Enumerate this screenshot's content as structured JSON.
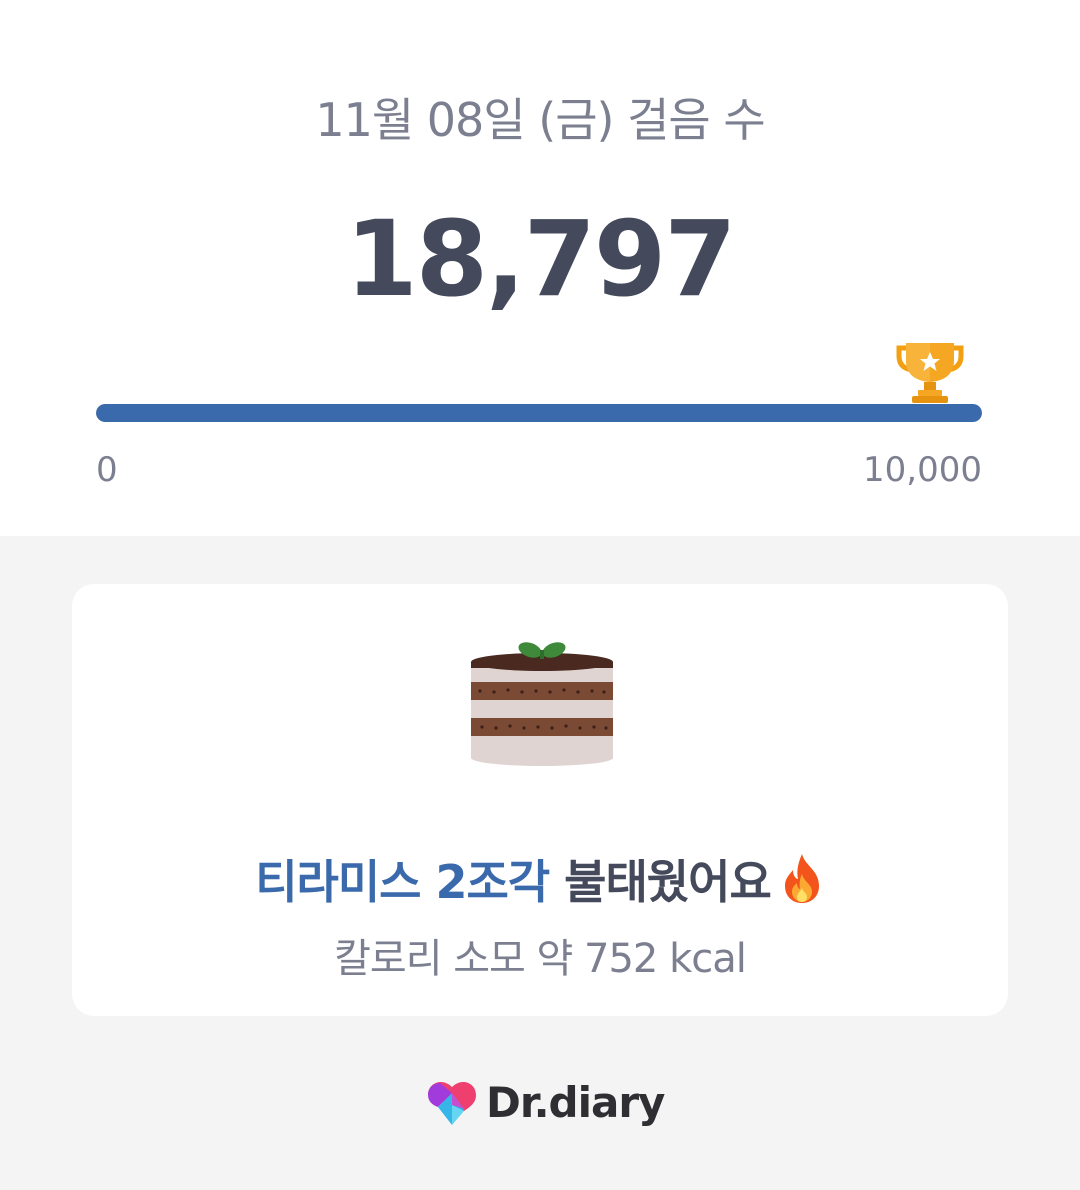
{
  "header": {
    "date_title": "11월 08일 (금) 걸음 수",
    "steps": "18,797"
  },
  "progress": {
    "fraction": 1.0,
    "min_label": "0",
    "goal_label": "10,000",
    "goal_icon": "trophy-icon",
    "fill_color": "#3a6aab"
  },
  "card": {
    "food_icon": "tiramisu-cake-icon",
    "headline_accent": "티라미스 2조각",
    "headline_rest": " 불태웠어요",
    "headline_icon": "fire-icon",
    "calorie_text": "칼로리 소모 약 752 kcal"
  },
  "brand": {
    "name": "Dr.diary",
    "logo_icon": "heart-logo-icon"
  }
}
